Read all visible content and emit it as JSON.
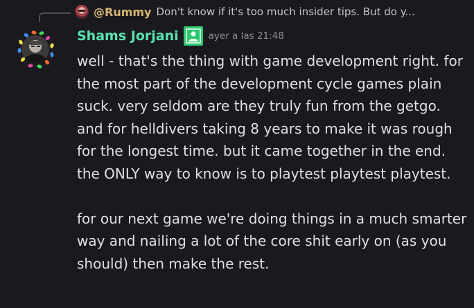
{
  "reply": {
    "author": "@Rummy",
    "preview": "Don't know if it's too much insider tips. But do y..."
  },
  "message": {
    "author": "Shams Jorjani",
    "timestamp": "ayer a las 21:48",
    "paragraphs": [
      "well - that's the thing with game development right. for the most part of the development cycle games plain suck. very seldom are they truly fun from the getgo. and for helldivers taking 8 years to make it was rough for the longest time. but it came together in the end. the ONLY way to know is to playtest playtest playtest.",
      "for our next game we're doing things in a much smarter way and nailing a lot of the core shit early on (as you should) then make the rest."
    ]
  },
  "colors": {
    "background": "#1a1a1e",
    "author": "#58e3b1",
    "reply_author": "#d4b572",
    "role_icon": "#2dc770",
    "text": "#dfe0e4",
    "timestamp": "#8e9098"
  },
  "icons": {
    "reply_avatar": "reply-avatar",
    "avatar": "profile-avatar-with-light-decoration",
    "role": "user-role-icon"
  }
}
